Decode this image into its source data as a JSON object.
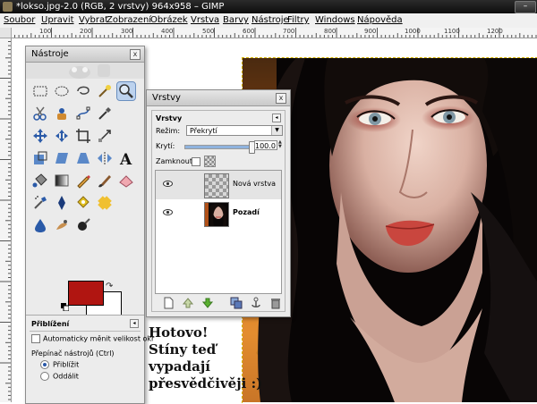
{
  "window": {
    "title": "*lokso.jpg-2.0 (RGB, 2 vrstvy) 964x958 – GIMP"
  },
  "menubar": {
    "items": [
      "Soubor",
      "Upravit",
      "Vybrat",
      "Zobrazení",
      "Obrázek",
      "Vrstva",
      "Barvy",
      "Nástroje",
      "Filtry",
      "Windows",
      "Nápověda"
    ]
  },
  "ruler": {
    "top_labels": [
      "100",
      "200",
      "300",
      "400",
      "500",
      "600",
      "700",
      "800",
      "900",
      "1000",
      "1100",
      "1200"
    ]
  },
  "toolbox": {
    "title": "Nástroje",
    "close": "x",
    "fg_color": "#b01511",
    "bg_color": "#ffffff",
    "active_tool": "zoom-icon",
    "options": {
      "title": "Přiblížení",
      "menu": "◂",
      "auto_resize_label": "Automaticky měnit velikost okr",
      "auto_resize_checked": false,
      "toggle_label": "Přepínač nástrojů  (Ctrl)",
      "zoom_in_label": "Přiblížit",
      "zoom_out_label": "Oddálit",
      "selected": "Přiblížit"
    }
  },
  "layers": {
    "title": "Vrstvy",
    "close": "x",
    "panel_title": "Vrstvy",
    "menu": "◂",
    "mode_label": "Režim:",
    "mode_value": "Překrytí",
    "opacity_label": "Krytí:",
    "opacity_value": "100.0",
    "opacity_fraction": 1.0,
    "lock_label": "Zamknout:",
    "items": [
      {
        "name": "Nová vrstva",
        "visible": true,
        "selected": true
      },
      {
        "name": "Pozadí",
        "visible": true,
        "selected": false
      }
    ]
  },
  "caption": {
    "lines": [
      "Hotovo!",
      "Stíny teď",
      "vypadají",
      "přesvědčivěji :)"
    ]
  },
  "colors": {
    "accent": "#b01511",
    "selection_highlight": "#bcd2ee",
    "dock_bg": "#ebebeb"
  }
}
